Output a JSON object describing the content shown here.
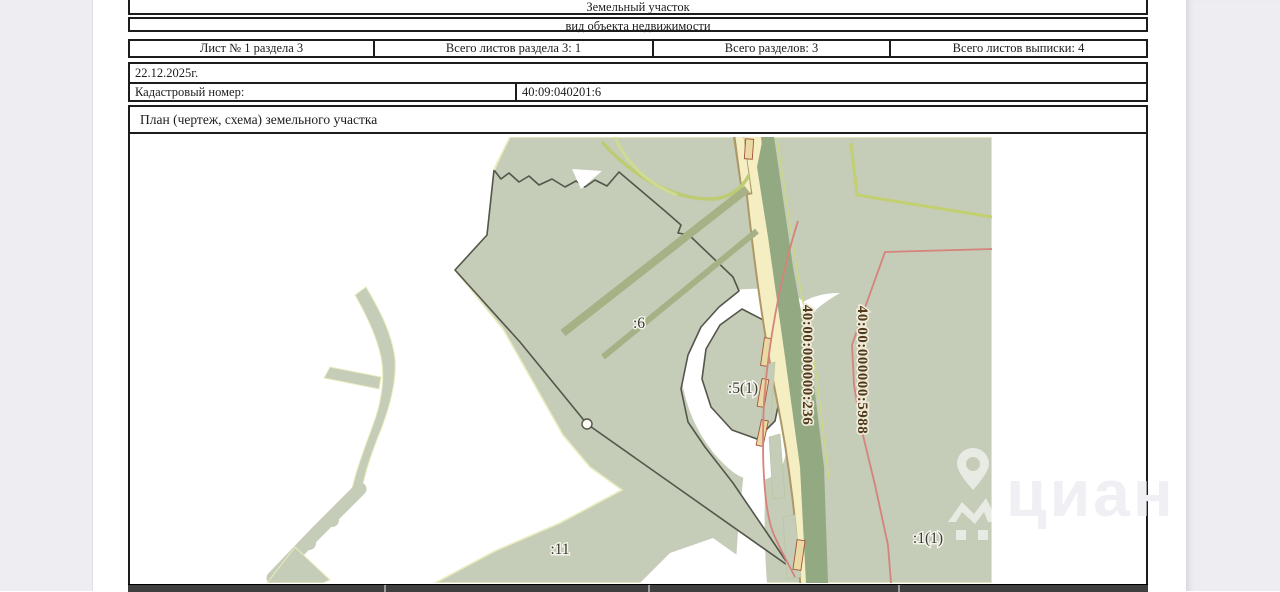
{
  "document": {
    "header": {
      "title": "Земельный участок",
      "subtitle": "вид объекта недвижимости"
    },
    "sheet_info": {
      "sheet": "Лист № 1 раздела 3",
      "sheets_in_section": "Всего листов раздела 3: 1",
      "sections_total": "Всего разделов: 3",
      "sheets_total": "Всего листов выписки: 4"
    },
    "date": "22.12.2025г.",
    "cadastral_number_label": "Кадастровый номер:",
    "cadastral_number_value": "40:09:040201:6",
    "plan_section_title": "План (чертеж, схема) земельного участка"
  },
  "map": {
    "parcel_labels": [
      ":6",
      ":5(1)",
      ":11",
      ":1(1)"
    ],
    "cadastral_line_labels": [
      "40:00:000000:236",
      "40:00:000000:5988"
    ],
    "colors": {
      "parcel_fill": "#c5ccb8",
      "parcel_pale_edge": "#e9edbd",
      "boundary_dark": "#54564b",
      "road_fill": "#f4eec2",
      "road_edge": "#ad9868",
      "vegetation_band": "#93a982",
      "green_line": "#a6b286",
      "chartreuse_line": "#c2d06e",
      "red_line": "#d5837b",
      "label_brown": "#4f3a1c",
      "label_dark": "#3a3a33"
    }
  },
  "watermark": {
    "text": "циан"
  }
}
